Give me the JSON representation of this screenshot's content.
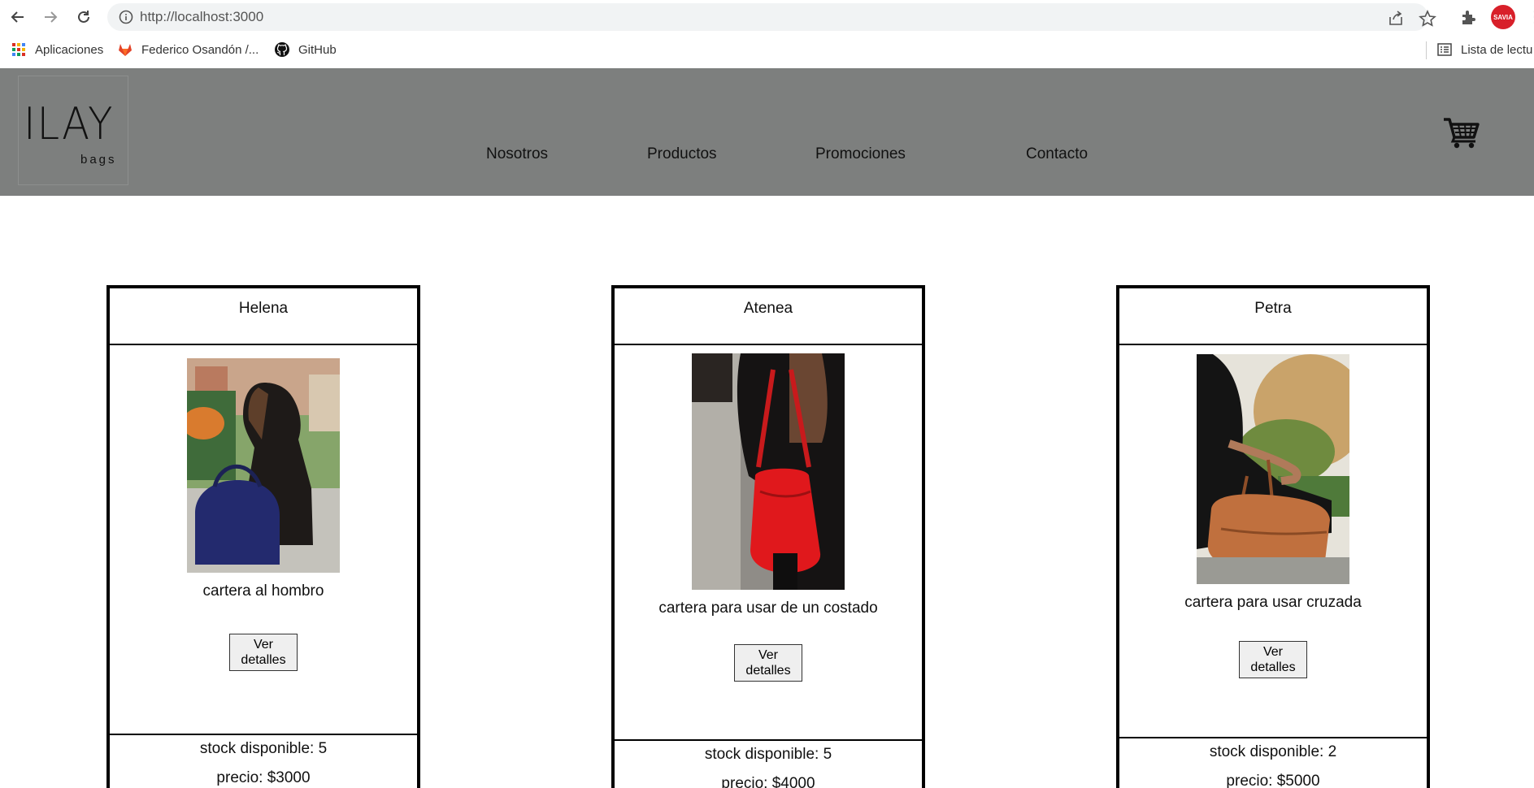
{
  "browser": {
    "url": "http://localhost:3000",
    "bookmarks": [
      {
        "label": "Aplicaciones",
        "icon": "apps-grid-icon"
      },
      {
        "label": "Federico Osandón /...",
        "icon": "gitlab-icon"
      },
      {
        "label": "GitHub",
        "icon": "github-icon"
      }
    ],
    "reading_list": "Lista de lectu",
    "profile": "SAVIA"
  },
  "site": {
    "logo_main": "ILAY",
    "logo_sub": "bags",
    "menu": [
      "Nosotros",
      "Productos",
      "Promociones",
      "Contacto"
    ],
    "cart_icon": "shopping-cart-icon"
  },
  "products": [
    {
      "name": "Helena",
      "description": "cartera al hombro",
      "button": "Ver detalles",
      "stock": "stock disponible: 5",
      "price": "precio: $3000",
      "bag_color": "#2a2f7a"
    },
    {
      "name": "Atenea",
      "description": "cartera para usar de un costado",
      "button": "Ver detalles",
      "stock": "stock disponible: 5",
      "price": "precio: $4000",
      "bag_color": "#e0181c"
    },
    {
      "name": "Petra",
      "description": "cartera para usar cruzada",
      "button": "Ver detalles",
      "stock": "stock disponible: 2",
      "price": "precio: $5000",
      "bag_color": "#c0703e"
    }
  ],
  "colors": {
    "header_bg": "#7d7f7e",
    "omnibox_bg": "#f1f3f4"
  }
}
